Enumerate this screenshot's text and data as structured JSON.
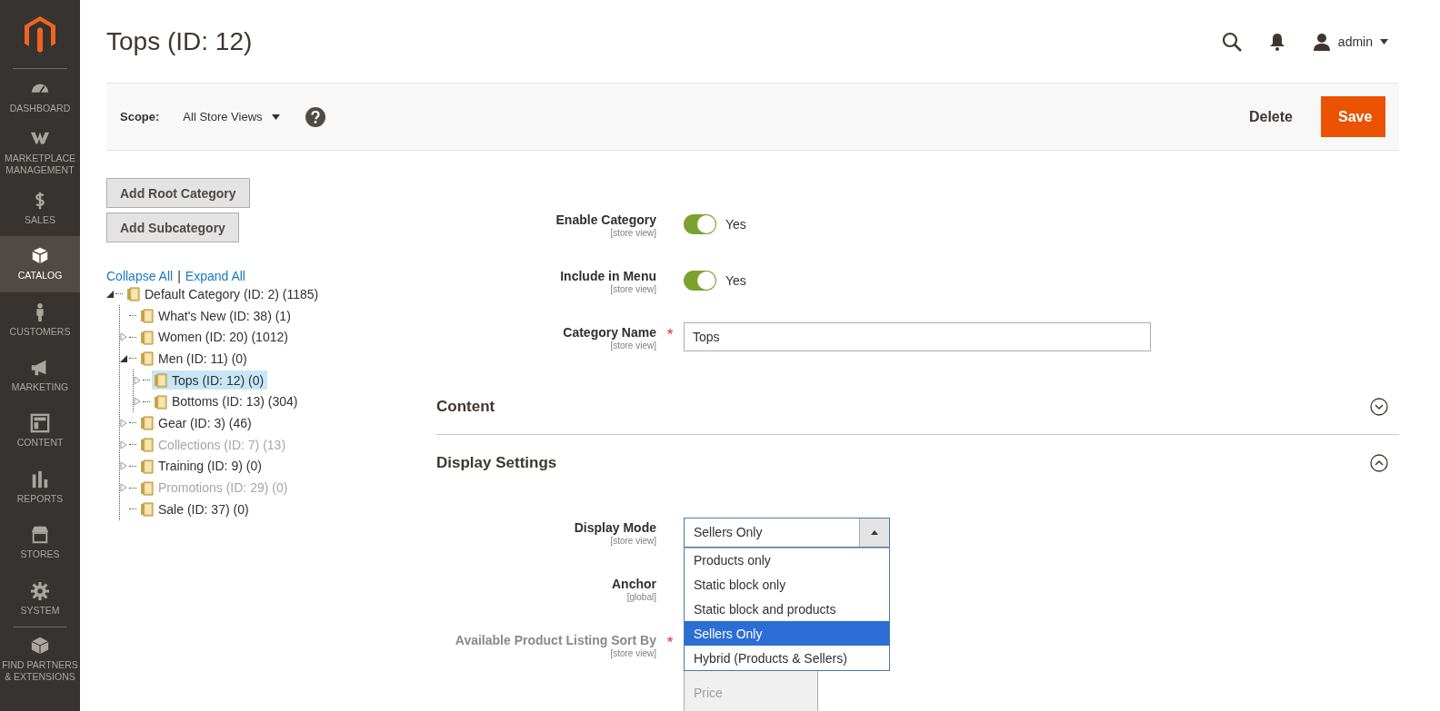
{
  "sidebar": {
    "items": [
      {
        "label": "DASHBOARD",
        "selected": false
      },
      {
        "label": "MARKETPLACE MANAGEMENT",
        "selected": false
      },
      {
        "label": "SALES",
        "selected": false
      },
      {
        "label": "CATALOG",
        "selected": true
      },
      {
        "label": "CUSTOMERS",
        "selected": false
      },
      {
        "label": "MARKETING",
        "selected": false
      },
      {
        "label": "CONTENT",
        "selected": false
      },
      {
        "label": "REPORTS",
        "selected": false
      },
      {
        "label": "STORES",
        "selected": false
      },
      {
        "label": "SYSTEM",
        "selected": false
      },
      {
        "label": "FIND PARTNERS & EXTENSIONS",
        "selected": false
      }
    ]
  },
  "header": {
    "title": "Tops (ID: 12)",
    "user": "admin"
  },
  "scope_bar": {
    "label": "Scope:",
    "value": "All Store Views",
    "actions": [
      "Delete",
      "Save"
    ]
  },
  "tree_panel": {
    "buttons": [
      "Add Root Category",
      "Add Subcategory"
    ],
    "links": [
      "Collapse All",
      "Expand All"
    ],
    "separator": "|",
    "tree": [
      {
        "label": "Default Category (ID: 2) (1185)",
        "kind": "branch",
        "expanded": true,
        "disabled": false,
        "selected": false,
        "children": [
          {
            "label": "What's New (ID: 38) (1)",
            "kind": "leaf",
            "disabled": false,
            "selected": false
          },
          {
            "label": "Women (ID: 20) (1012)",
            "kind": "branch",
            "expanded": false,
            "disabled": false,
            "selected": false
          },
          {
            "label": "Men (ID: 11) (0)",
            "kind": "branch",
            "expanded": true,
            "disabled": false,
            "selected": false,
            "children": [
              {
                "label": "Tops (ID: 12) (0)",
                "kind": "branch",
                "expanded": false,
                "disabled": false,
                "selected": true
              },
              {
                "label": "Bottoms (ID: 13) (304)",
                "kind": "branch",
                "expanded": false,
                "disabled": false,
                "selected": false
              }
            ]
          },
          {
            "label": "Gear (ID: 3) (46)",
            "kind": "branch",
            "expanded": false,
            "disabled": false,
            "selected": false
          },
          {
            "label": "Collections (ID: 7) (13)",
            "kind": "branch",
            "expanded": false,
            "disabled": true,
            "selected": false
          },
          {
            "label": "Training (ID: 9) (0)",
            "kind": "branch",
            "expanded": false,
            "disabled": false,
            "selected": false
          },
          {
            "label": "Promotions (ID: 29) (0)",
            "kind": "branch",
            "expanded": false,
            "disabled": true,
            "selected": false
          },
          {
            "label": "Sale (ID: 37) (0)",
            "kind": "leaf",
            "disabled": false,
            "selected": false
          }
        ]
      }
    ]
  },
  "form": {
    "fields": [
      {
        "kind": "toggle",
        "label": "Enable Category",
        "scope": "[store view]",
        "disabled": false,
        "on": true,
        "value": "Yes"
      },
      {
        "kind": "toggle",
        "label": "Include in Menu",
        "scope": "[store view]",
        "disabled": false,
        "on": true,
        "value": "Yes"
      },
      {
        "kind": "text",
        "label": "Category Name",
        "scope": "[store view]",
        "required_mark": "*",
        "disabled": false,
        "value": "Tops"
      }
    ],
    "sections": [
      {
        "title": "Content",
        "expanded": false
      },
      {
        "title": "Display Settings",
        "expanded": true,
        "fields": [
          {
            "kind": "select",
            "label": "Display Mode",
            "scope": "[store view]",
            "disabled": false,
            "value": "Sellers Only",
            "open": true,
            "options": [
              {
                "label": "Products only",
                "selected": false
              },
              {
                "label": "Static block only",
                "selected": false
              },
              {
                "label": "Static block and products",
                "selected": false
              },
              {
                "label": "Sellers Only",
                "selected": true
              },
              {
                "label": "Hybrid (Products & Sellers)",
                "selected": false
              }
            ]
          },
          {
            "kind": "covered",
            "label": "Anchor",
            "scope": "[global]",
            "disabled": false
          },
          {
            "kind": "multiselect",
            "label": "Available Product Listing Sort By",
            "scope": "[store view]",
            "required_mark": "*",
            "disabled": true,
            "options": [
              "Price"
            ]
          }
        ]
      }
    ]
  }
}
